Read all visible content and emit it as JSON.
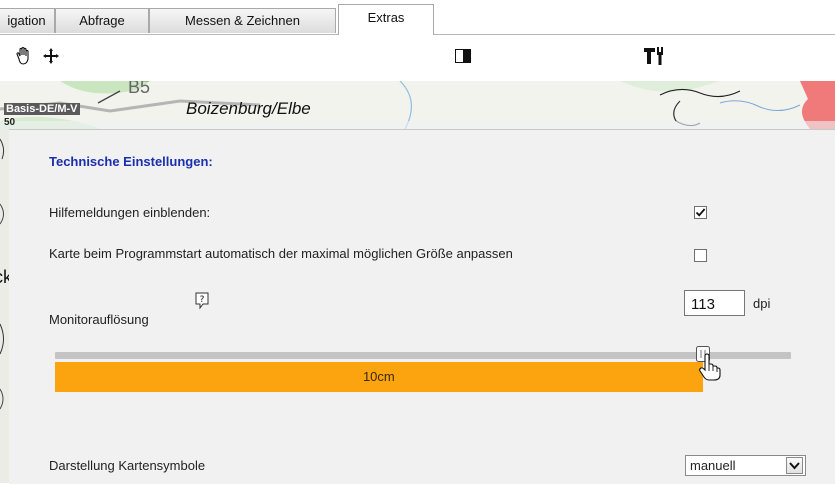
{
  "tabs": [
    {
      "label": "igation",
      "active": false
    },
    {
      "label": "Abfrage",
      "active": false
    },
    {
      "label": "Messen & Zeichnen",
      "active": false
    },
    {
      "label": "Extras",
      "active": true
    }
  ],
  "toolbar": {
    "icons": [
      "pan-hand-icon",
      "move-arrows-icon",
      "half-filled-square-icon",
      "tools-icon"
    ]
  },
  "map": {
    "road_label": "B5",
    "city_label": "Boizenburg/Elbe",
    "layer_label": "Basis-DE/M-V",
    "scale_fragment": "50",
    "partial_letters": "ck"
  },
  "settings": {
    "title": "Technische Einstellungen:",
    "show_help": {
      "label": "Hilfemeldungen einblenden:",
      "checked": true
    },
    "auto_resize": {
      "label": "Karte beim Programmstart automatisch der maximal möglichen Größe anpassen",
      "checked": false
    },
    "monitor": {
      "label": "Monitorauflösung",
      "dpi_value": "113",
      "dpi_unit": "dpi",
      "slider_label": "10cm",
      "slider_fraction": 0.88
    },
    "symbols": {
      "label": "Darstellung Kartensymbole",
      "selected": "manuell"
    }
  },
  "colors": {
    "title_blue": "#1a2fae",
    "slider_fill": "#fba410",
    "panel_bg": "#f1f1f1"
  }
}
